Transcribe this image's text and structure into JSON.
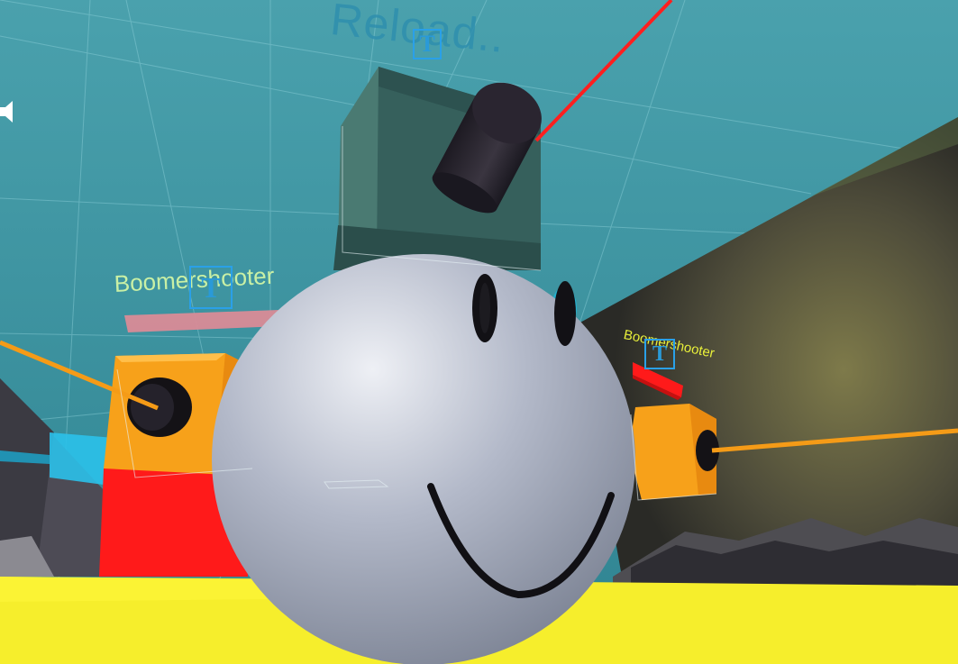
{
  "hud": {
    "reload_text": "Reload..",
    "audio_icon": "speaker-icon"
  },
  "players": [
    {
      "name": "Boomershooter",
      "side": "left"
    },
    {
      "name": "Boomershooter",
      "side": "right"
    }
  ],
  "gizmos": {
    "transform_icon": "T"
  },
  "colors": {
    "sky": "#3a8f9c",
    "ground": "#f3ee2a",
    "player_body": "#f59b17",
    "health_bar": "#ff1b1b",
    "laser": "#ff2020",
    "smiley": "#b9bfcd"
  }
}
